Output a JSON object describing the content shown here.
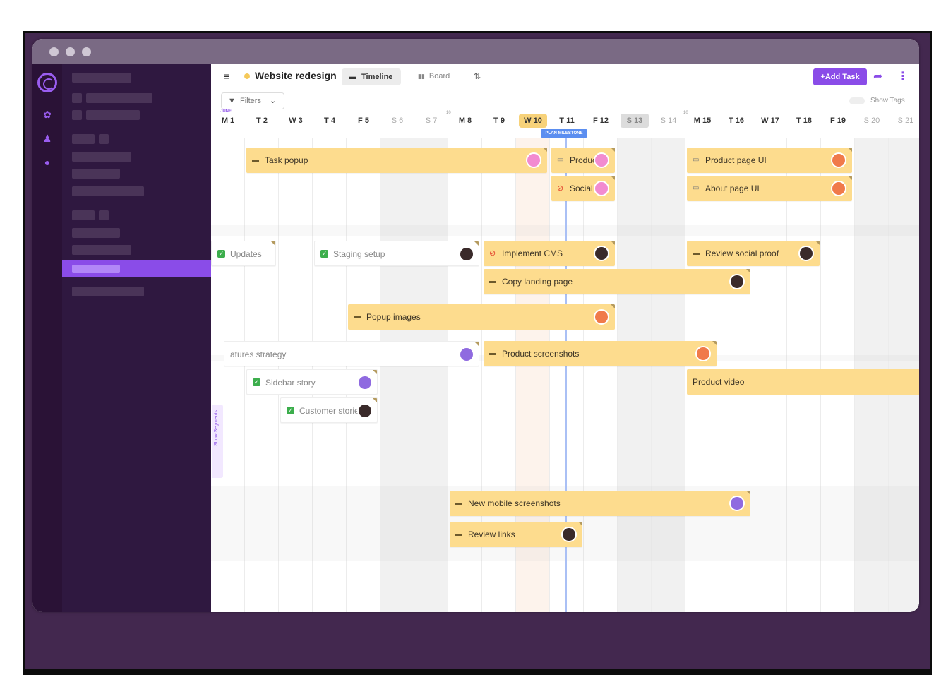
{
  "app": {
    "project_title": "Website redesign",
    "tabs": {
      "timeline": "Timeline",
      "board": "Board"
    },
    "add_task": "+Add Task",
    "filters": "Filters",
    "show_tags": "Show Tags",
    "month": "JUNE",
    "milestone": "PLAN MILESTONE",
    "show_segments": "Show Segments",
    "colors": {
      "accent": "#8a4ce8",
      "bar": "#fddc8e",
      "sidebar": "#2f1840",
      "rail": "#2a1236",
      "frame": "#43284f",
      "milestone": "#5b8ef0"
    }
  },
  "days": [
    "M 1",
    "T 2",
    "W 3",
    "T 4",
    "F 5",
    "S 6",
    "S 7",
    "M 8",
    "T 9",
    "W 10",
    "T 11",
    "F 12",
    "S 13",
    "S 14",
    "M 15",
    "T 16",
    "W 17",
    "T 18",
    "F 19",
    "S 20",
    "S 21"
  ],
  "weeknos": [
    "10",
    "10"
  ],
  "tasks": [
    {
      "label": "Task popup",
      "icon": "flag-icon",
      "avatar": "pink"
    },
    {
      "label": "Produc",
      "icon": "doc-icon",
      "avatar": "pink"
    },
    {
      "label": "Product page UI",
      "icon": "doc-icon",
      "avatar": "orange"
    },
    {
      "label": "Social",
      "icon": "block-icon",
      "avatar": "pink"
    },
    {
      "label": "About page UI",
      "icon": "doc-icon",
      "avatar": "orange"
    },
    {
      "label": "Updates",
      "icon": "check-icon",
      "avatar": ""
    },
    {
      "label": "Staging setup",
      "icon": "check-icon",
      "avatar": "dark"
    },
    {
      "label": "Implement CMS",
      "icon": "block-icon",
      "avatar": "dark"
    },
    {
      "label": "Review social proof",
      "icon": "flag-icon",
      "avatar": "dark"
    },
    {
      "label": "Copy landing page",
      "icon": "flag-icon",
      "avatar": "dark"
    },
    {
      "label": "Popup images",
      "icon": "flag-icon",
      "avatar": "orange"
    },
    {
      "label": "atures strategy",
      "icon": "",
      "avatar": "purple"
    },
    {
      "label": "Product screenshots",
      "icon": "flag-icon",
      "avatar": "orange"
    },
    {
      "label": "Sidebar story",
      "icon": "check-icon",
      "avatar": "purple"
    },
    {
      "label": "Product video",
      "icon": "",
      "avatar": ""
    },
    {
      "label": "Customer storie",
      "icon": "check-icon",
      "avatar": "dark"
    },
    {
      "label": "New mobile screenshots",
      "icon": "flag-icon",
      "avatar": "purple"
    },
    {
      "label": "Review links",
      "icon": "flag-icon",
      "avatar": "dark"
    }
  ]
}
